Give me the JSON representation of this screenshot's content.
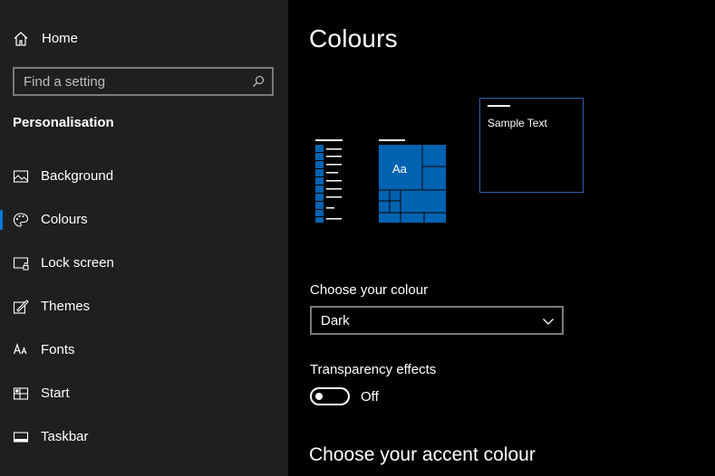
{
  "sidebar": {
    "home_label": "Home",
    "search_placeholder": "Find a setting",
    "section_title": "Personalisation",
    "items": [
      {
        "label": "Background",
        "icon": "image-icon",
        "selected": false
      },
      {
        "label": "Colours",
        "icon": "palette-icon",
        "selected": true
      },
      {
        "label": "Lock screen",
        "icon": "lock-screen-icon",
        "selected": false
      },
      {
        "label": "Themes",
        "icon": "themes-icon",
        "selected": false
      },
      {
        "label": "Fonts",
        "icon": "fonts-icon",
        "selected": false
      },
      {
        "label": "Start",
        "icon": "start-icon",
        "selected": false
      },
      {
        "label": "Taskbar",
        "icon": "taskbar-icon",
        "selected": false
      }
    ]
  },
  "main": {
    "title": "Colours",
    "preview": {
      "sample_text": "Sample Text",
      "tile_text": "Aa"
    },
    "choose_colour": {
      "label": "Choose your colour",
      "value": "Dark"
    },
    "transparency": {
      "label": "Transparency effects",
      "state": "Off"
    },
    "accent_heading": "Choose your accent colour"
  },
  "colors": {
    "accent": "#0063b1",
    "selection": "#0078d7",
    "sidebar_bg": "#1f1f1f",
    "main_bg": "#000000"
  }
}
